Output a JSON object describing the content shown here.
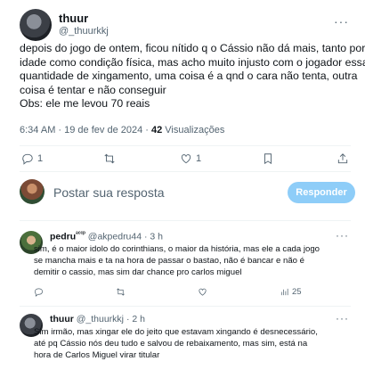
{
  "post": {
    "author_name": "thuur",
    "author_handle": "@_thuurkkj",
    "more_label": "···",
    "text_lines": [
      "depois do jogo de ontem, ficou nítido q o Cássio não dá mais, tanto por",
      "idade como condição física, mas acho muito injusto com o jogador essa",
      "quantidade de xingamento, uma coisa é a qnd o cara não tenta, outra",
      "coisa é tentar e não conseguir",
      "Obs: ele me levou 70 reais"
    ],
    "time": "6:34 AM · 19 de fev de 2024 · ",
    "views_count": "42",
    "views_label": " Visualizações",
    "actions": {
      "reply_count": "1",
      "retweet_count": "",
      "like_count": "1",
      "bookmark_count": "",
      "share_count": ""
    },
    "icons": [
      "reply-icon",
      "retweet-icon",
      "like-icon",
      "bookmark-icon",
      "share-icon"
    ]
  },
  "reply_box": {
    "placeholder": "Postar sua resposta",
    "button_label": "Responder",
    "button_color": "#8ecdf8"
  },
  "comments": [
    {
      "name": "pedru",
      "badge": "ᵃᶜᶜᵖ",
      "handle": "@akpedru44",
      "time": "· 3 h",
      "text_lines": [
        "sim, é o maior idolo do corinthians, o maior da história, mas ele a cada jogo",
        "se mancha mais e ta na hora de passar o bastao, não é bancar e não é",
        "demitir o cassio, mas sim dar chance pro carlos miguel"
      ],
      "views": "25"
    },
    {
      "name": "thuur",
      "badge": "",
      "handle": "@_thuurkkj",
      "time": "· 2 h",
      "text_lines": [
        "Sim irmão, mas xingar ele do jeito que estavam xingando é desnecessário,",
        "até pq Cássio nós deu tudo e salvou de rebaixamento, mas sim, está na",
        "hora de Carlos Miguel virar titular"
      ],
      "views": ""
    }
  ],
  "colors": {
    "text": "#0f1419",
    "muted": "#536471",
    "divider": "#eff3f4",
    "accent": "#1d9bf0"
  }
}
